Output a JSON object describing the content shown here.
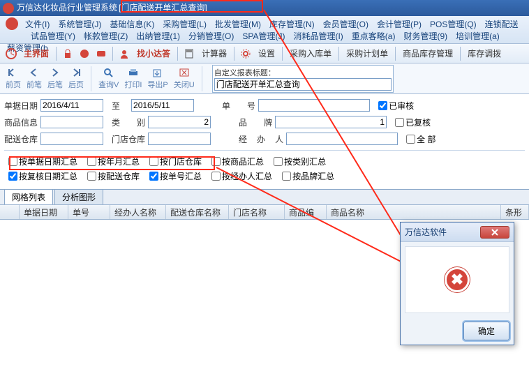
{
  "title": {
    "app": "万信达化妆品行业管理系统",
    "sub": "[门店配送开单汇总查询]"
  },
  "menu": {
    "row1": [
      "文件(I)",
      "系统管理(J)",
      "基础信息(K)",
      "采购管理(L)",
      "批发管理(M)",
      "库存管理(N)",
      "会员管理(O)",
      "会计管理(P)",
      "POS管理(Q)",
      "连锁配送"
    ],
    "row2": [
      "试品管理(Y)",
      "帐款管理(Z)",
      "出纳管理(1)",
      "分销管理(O)",
      "SPA管理(J)",
      "消耗品管理(I)",
      "重点客略(a)",
      "财务管理(9)",
      "培训管理(a)",
      "薪资管理(b"
    ]
  },
  "toolbar": {
    "main": "主界面",
    "find": "找小达答",
    "calc": "计算器",
    "set": "设置",
    "a": "采购入库单",
    "b": "采购计划单",
    "c": "商品库存管理",
    "d": "库存调拨"
  },
  "nav": {
    "first": "前页",
    "prev": "前笔",
    "next": "后笔",
    "last": "后页",
    "query": "查询V",
    "print": "打印I",
    "export": "导出P",
    "close": "关闭U"
  },
  "report": {
    "lbl": "自定义报表标题：",
    "val": "门店配送开单汇总查询"
  },
  "filter": {
    "dateLbl": "单据日期",
    "dateFrom": "2016/4/11",
    "toLbl": "至",
    "dateTo": "2016/5/11",
    "danLbl": "单",
    "haoLbl": "号",
    "danhao": "",
    "spLbl": "商品信息",
    "spVal": "",
    "leiLbl": "类",
    "bieLbl": "别",
    "leibie": "2",
    "pinLbl": "品",
    "paiLbl": "牌",
    "pinpai": "1",
    "psLbl": "配送仓库",
    "psVal": "",
    "mdLbl": "门店仓库",
    "mdVal": "",
    "jbLbl": "经",
    "bLbl": "办",
    "rLbl": "人",
    "jbr": "",
    "audited": "已审核",
    "reviewed": "已复核",
    "all": "全 部"
  },
  "sums": {
    "s1": "按单据日期汇总",
    "s2": "按年月汇总",
    "s3": "按门店仓库",
    "s4": "按商品汇总",
    "s5": "按类别汇总",
    "s6": "按复核日期汇总",
    "s7": "按配送仓库",
    "s8": "按单号汇总",
    "s9": "按经办人汇总",
    "s10": "按品牌汇总"
  },
  "tabs": {
    "t1": "网格列表",
    "t2": "分析图形"
  },
  "cols": {
    "c0": "",
    "c1": "单据日期",
    "c2": "单号",
    "c3": "经办人名称",
    "c4": "配送仓库名称",
    "c5": "门店名称",
    "c6": "商品编",
    "c7": "商品名称",
    "c8": "条形"
  },
  "dialog": {
    "title": "万信达软件",
    "ok": "确定"
  }
}
